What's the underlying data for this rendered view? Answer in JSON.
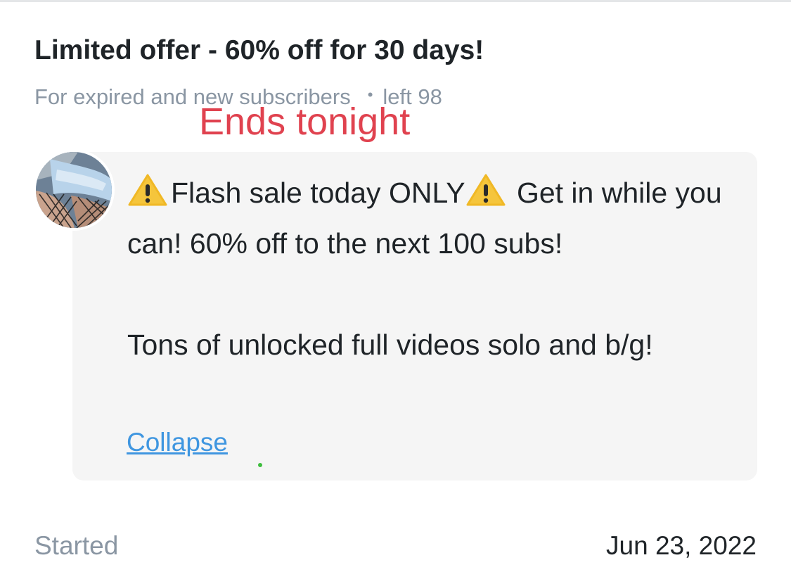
{
  "offer": {
    "title": "Limited offer - 60% off for 30 days!",
    "audience": "For expired and new subscribers",
    "remaining": "left 98"
  },
  "annotation": {
    "text": "Ends tonight",
    "color": "#e0424f"
  },
  "message": {
    "line_a": "Flash sale today ONLY",
    "line_b": " Get in while you can! 60% off to the next 100 subs!",
    "paragraph_2": "Tons of unlocked full videos solo and b/g!",
    "warning_icon": "warning-emoji-icon",
    "collapse_label": "Collapse"
  },
  "avatar": {
    "icon": "profile-photo-avatar"
  },
  "footer": {
    "started_label": "Started",
    "started_date": "Jun 23, 2022"
  },
  "colors": {
    "link": "#3f96e0",
    "muted": "#8a96a3",
    "card_bg": "#f5f5f5",
    "online_dot": "#3ebd3e"
  }
}
